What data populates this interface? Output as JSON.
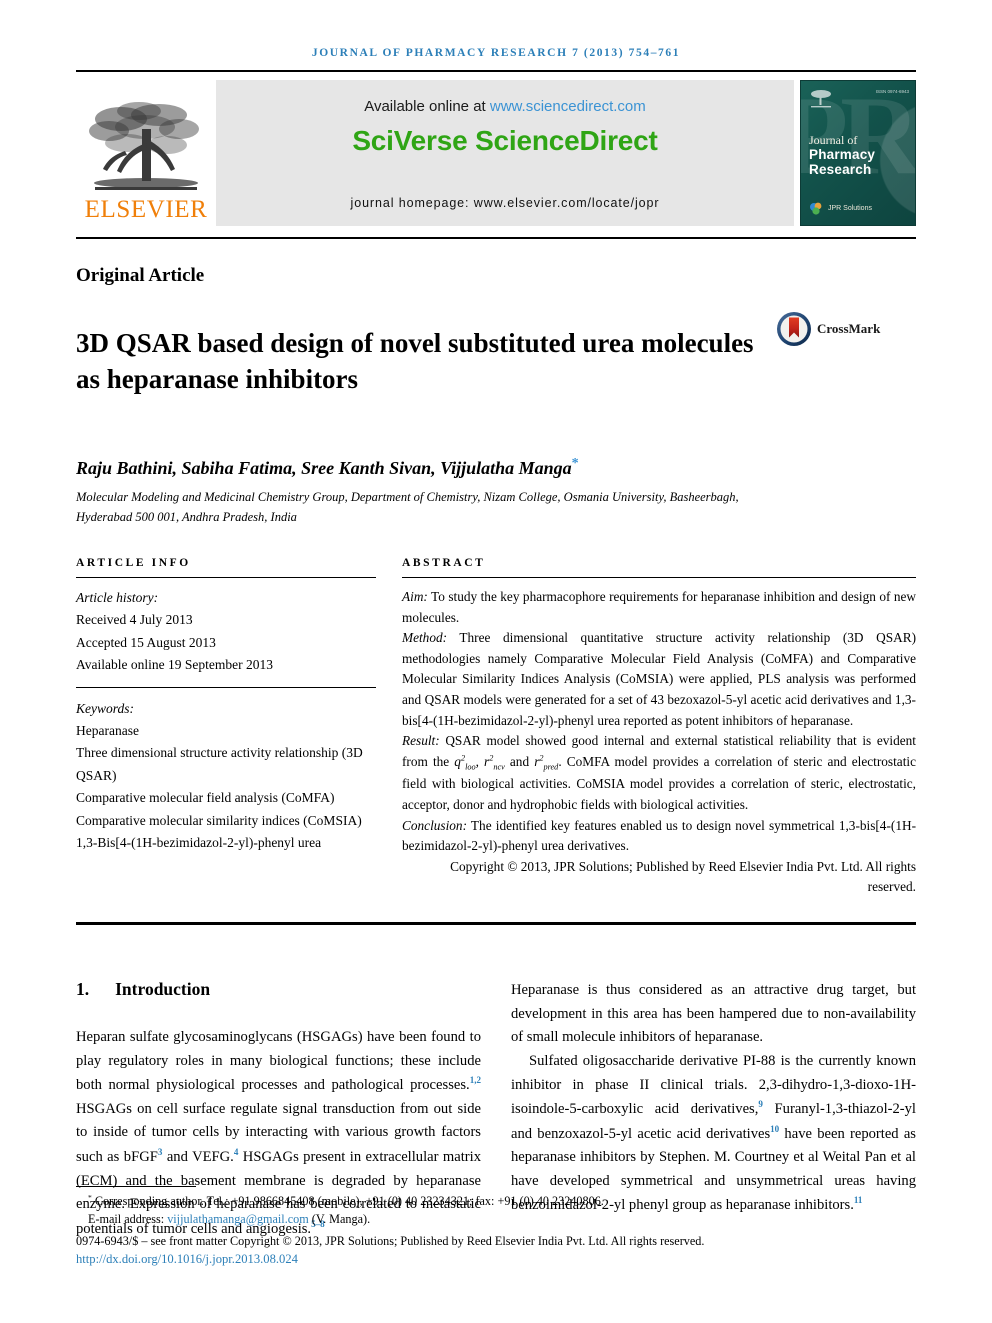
{
  "running_head": "Journal of Pharmacy Research 7 (2013) 754–761",
  "masthead": {
    "publisher_name": "ELSEVIER",
    "available_prefix": "Available online at ",
    "available_url": "www.sciencedirect.com",
    "brand": "SciVerse ScienceDirect",
    "homepage": "journal homepage: www.elsevier.com/locate/jopr",
    "cover": {
      "title_small": "Journal of",
      "title_large": "Pharmacy Research",
      "issn": "ISSN 0974-6943",
      "watermark": "PR",
      "publisher_mark": "JPR Solutions"
    }
  },
  "article": {
    "type": "Original Article",
    "title": "3D QSAR based design of novel substituted urea molecules as heparanase inhibitors",
    "crossmark_label": "CrossMark",
    "authors": "Raju Bathini, Sabiha Fatima, Sree Kanth Sivan, Vijjulatha Manga",
    "corresponding_marker": "*",
    "affiliation": "Molecular Modeling and Medicinal Chemistry Group, Department of Chemistry, Nizam College, Osmania University, Basheerbagh, Hyderabad 500 001, Andhra Pradesh, India"
  },
  "article_info": {
    "heading": "Article info",
    "history_label": "Article history:",
    "history": [
      "Received 4 July 2013",
      "Accepted 15 August 2013",
      "Available online 19 September 2013"
    ],
    "keywords_label": "Keywords:",
    "keywords": [
      "Heparanase",
      "Three dimensional structure activity relationship (3D QSAR)",
      "Comparative molecular field analysis (CoMFA)",
      "Comparative molecular similarity indices (CoMSIA)",
      "1,3-Bis[4-(1H-bezimidazol-2-yl)-phenyl urea"
    ]
  },
  "abstract": {
    "heading": "Abstract",
    "aim_label": "Aim:",
    "aim_text": " To study the key pharmacophore requirements for heparanase inhibition and design of new molecules.",
    "method_label": "Method:",
    "method_text": " Three dimensional quantitative structure activity relationship (3D QSAR) methodologies namely Comparative Molecular Field Analysis (CoMFA) and Comparative Molecular Similarity Indices Analysis (CoMSIA) were applied, PLS analysis was performed and QSAR models were generated for a set of 43 bezoxazol-5-yl acetic acid derivatives and 1,3-bis[4-(1H-bezimidazol-2-yl)-phenyl urea reported as potent inhibitors of heparanase.",
    "result_label": "Result:",
    "result_text_1": " QSAR model showed good internal and external statistical reliability that is evident from the ",
    "result_stat_1": "q",
    "result_stat_1_sub": "loo",
    "result_stat_2": "r",
    "result_stat_2_sub": "ncv",
    "result_stat_3": "r",
    "result_stat_3_sub": "pred",
    "result_text_2": ". CoMFA model provides a correlation of steric and electrostatic field with biological activities. CoMSIA model provides a correlation of steric, electrostatic, acceptor, donor and hydrophobic fields with biological activities.",
    "conclusion_label": "Conclusion:",
    "conclusion_text": " The identified key features enabled us to design novel symmetrical 1,3-bis[4-(1H-bezimidazol-2-yl)-phenyl urea derivatives.",
    "copyright": "Copyright © 2013, JPR Solutions; Published by Reed Elsevier India Pvt. Ltd. All rights reserved."
  },
  "introduction": {
    "number": "1.",
    "heading": "Introduction",
    "left_paragraph_parts": {
      "p1_a": "Heparan sulfate glycosaminoglycans (HSGAGs) have been found to play regulatory roles in many biological functions; these include both normal physiological processes and pathological processes.",
      "p1_ref1": "1,2",
      "p1_b": " HSGAGs on cell surface regulate signal transduction from out side to inside of tumor cells by interacting with various growth factors such as bFGF",
      "p1_ref2": "3",
      "p1_c": " and VEFG.",
      "p1_ref3": "4",
      "p1_d": " HSGAGs present in extracellular matrix (ECM) and the basement membrane is degraded by heparanase enzyme. Expression of heparanase has been correlated to metastatic potentials of tumor cells and angiogesis.",
      "p1_ref4": "5–8"
    },
    "right_paragraph_parts": {
      "p2": "Heparanase is thus considered as an attractive drug target, but development in this area has been hampered due to non-availability of small molecule inhibitors of heparanase.",
      "p3_a": "Sulfated oligosaccharide derivative PI-88 is the currently known inhibitor in phase II clinical trials. 2,3-dihydro-1,3-dioxo-1H-isoindole-5-carboxylic acid derivatives,",
      "p3_ref1": "9",
      "p3_b": " Furanyl-1,3-thiazol-2-yl and benzoxazol-5-yl acetic acid derivatives",
      "p3_ref2": "10",
      "p3_c": " have been reported as heparanase inhibitors by Stephen. M. Courtney et al Weital Pan et al have developed symmetrical and unsymmetrical ureas having benzoimidazol-2-yl phenyl group as heparanase inhibitors.",
      "p3_ref3": "11"
    }
  },
  "footnote": {
    "star": "*",
    "corresponding": "Corresponding author. Tel.: +91 9866845408 (mobile), +91 (0) 40 23234321; fax: +91 (0) 40 23240806.",
    "email_label": "E-mail address: ",
    "email": "vijjulathamanga@gmail.com",
    "email_suffix": " (V. Manga).",
    "front_matter": "0974-6943/$ – see front matter Copyright © 2013, JPR Solutions; Published by Reed Elsevier India Pvt. Ltd. All rights reserved.",
    "doi": "http://dx.doi.org/10.1016/j.jopr.2013.08.024"
  },
  "colors": {
    "running_head": "#2c7fb8",
    "elsevier_orange": "#f07f09",
    "sciencedirect_green": "#2fa515",
    "link_blue": "#2c7fb8",
    "banner_gray": "#e6e6e6",
    "cover_teal": "#16564f",
    "crossmark_red": "#cc2b1e",
    "crossmark_blue": "#1b3f6b"
  }
}
